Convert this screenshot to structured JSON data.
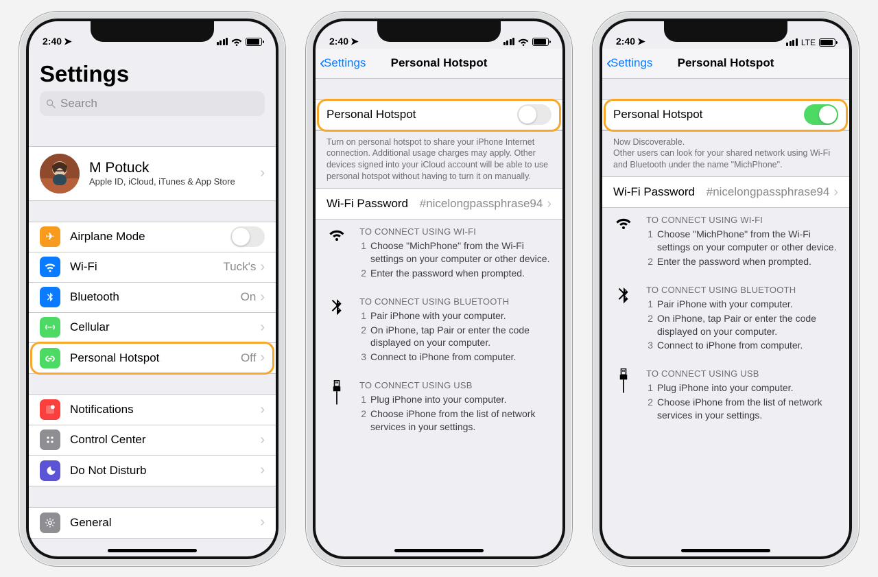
{
  "status": {
    "time": "2:40",
    "carrier_indicator": "LTE"
  },
  "phone1": {
    "title": "Settings",
    "search_placeholder": "Search",
    "profile": {
      "name": "M Potuck",
      "subtitle": "Apple ID, iCloud, iTunes & App Store"
    },
    "rows": {
      "airplane": "Airplane Mode",
      "wifi": {
        "label": "Wi-Fi",
        "value": "Tuck's"
      },
      "bluetooth": {
        "label": "Bluetooth",
        "value": "On"
      },
      "cellular": "Cellular",
      "hotspot": {
        "label": "Personal Hotspot",
        "value": "Off"
      },
      "notifications": "Notifications",
      "control_center": "Control Center",
      "dnd": "Do Not Disturb",
      "general": "General"
    }
  },
  "hotspot": {
    "back": "Settings",
    "title": "Personal Hotspot",
    "toggle_label": "Personal Hotspot",
    "off_footer": "Turn on personal hotspot to share your iPhone Internet connection. Additional usage charges may apply. Other devices signed into your iCloud account will be able to use personal hotspot without having to turn it on manually.",
    "on_footer_line1": "Now Discoverable.",
    "on_footer_line2": "Other users can look for your shared network using Wi-Fi and Bluetooth under the name \"MichPhone\".",
    "wifi_pw_label": "Wi-Fi Password",
    "wifi_pw_value": "#nicelongpassphrase94",
    "instr_wifi": {
      "title": "TO CONNECT USING WI-FI",
      "s1": "Choose \"MichPhone\" from the Wi-Fi settings on your computer or other device.",
      "s2": "Enter the password when prompted."
    },
    "instr_bt": {
      "title": "TO CONNECT USING BLUETOOTH",
      "s1": "Pair iPhone with your computer.",
      "s2": "On iPhone, tap Pair or enter the code displayed on your computer.",
      "s3": "Connect to iPhone from computer."
    },
    "instr_usb": {
      "title": "TO CONNECT USING USB",
      "s1": "Plug iPhone into your computer.",
      "s2": "Choose iPhone from the list of network services in your settings."
    }
  }
}
